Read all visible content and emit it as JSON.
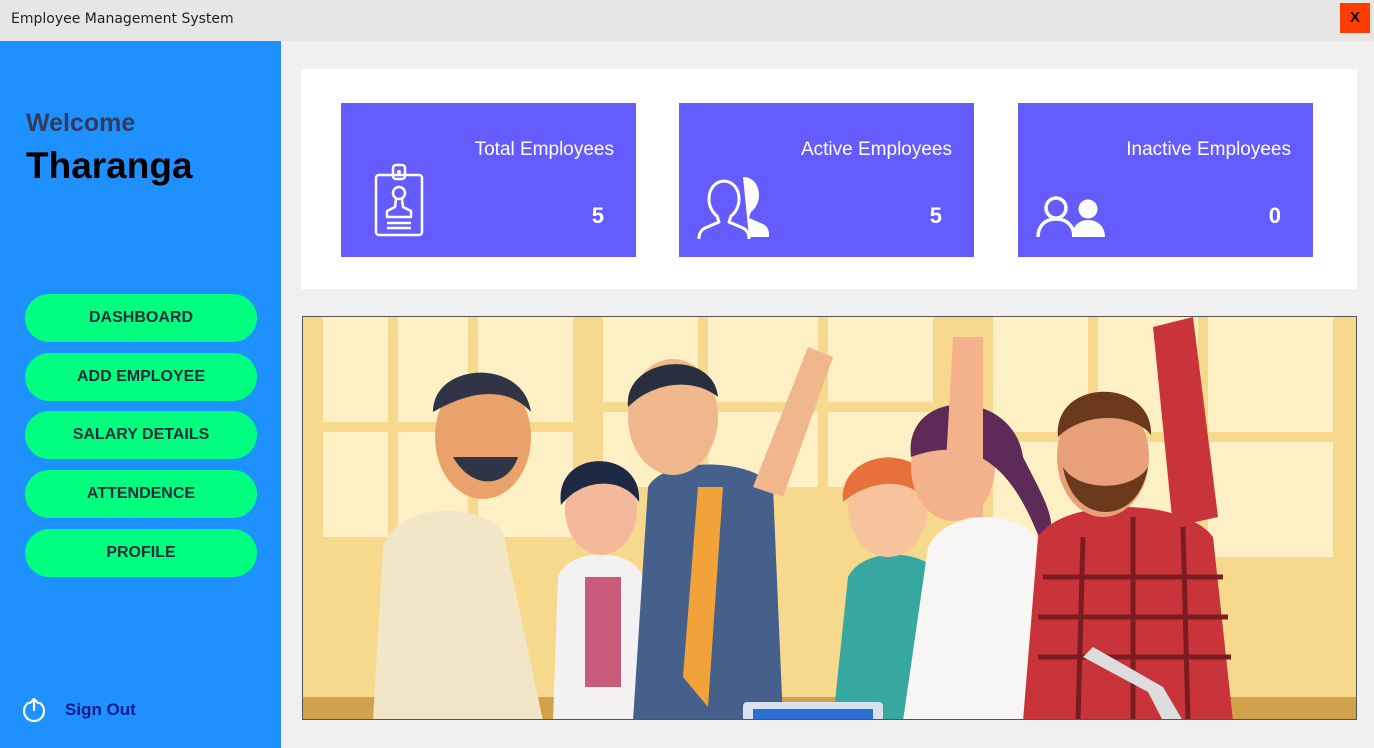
{
  "window": {
    "title": "Employee Management System",
    "close_label": "X"
  },
  "sidebar": {
    "welcome": "Welcome",
    "username": "Tharanga",
    "nav": [
      {
        "label": "DASHBOARD"
      },
      {
        "label": "ADD EMPLOYEE"
      },
      {
        "label": "SALARY DETAILS"
      },
      {
        "label": "ATTENDENCE"
      },
      {
        "label": "PROFILE"
      }
    ],
    "signout": {
      "label": "Sign Out",
      "icon": "power-icon"
    }
  },
  "stats": [
    {
      "title": "Total Employees",
      "value": "5",
      "icon": "id-badge-icon"
    },
    {
      "title": "Active Employees",
      "value": "5",
      "icon": "users-icon"
    },
    {
      "title": "Inactive Employees",
      "value": "0",
      "icon": "users-outline-icon"
    }
  ],
  "colors": {
    "sidebar": "#1e90ff",
    "nav_button": "#00ff7f",
    "card": "#655cff",
    "close_button": "#ff3d00"
  }
}
